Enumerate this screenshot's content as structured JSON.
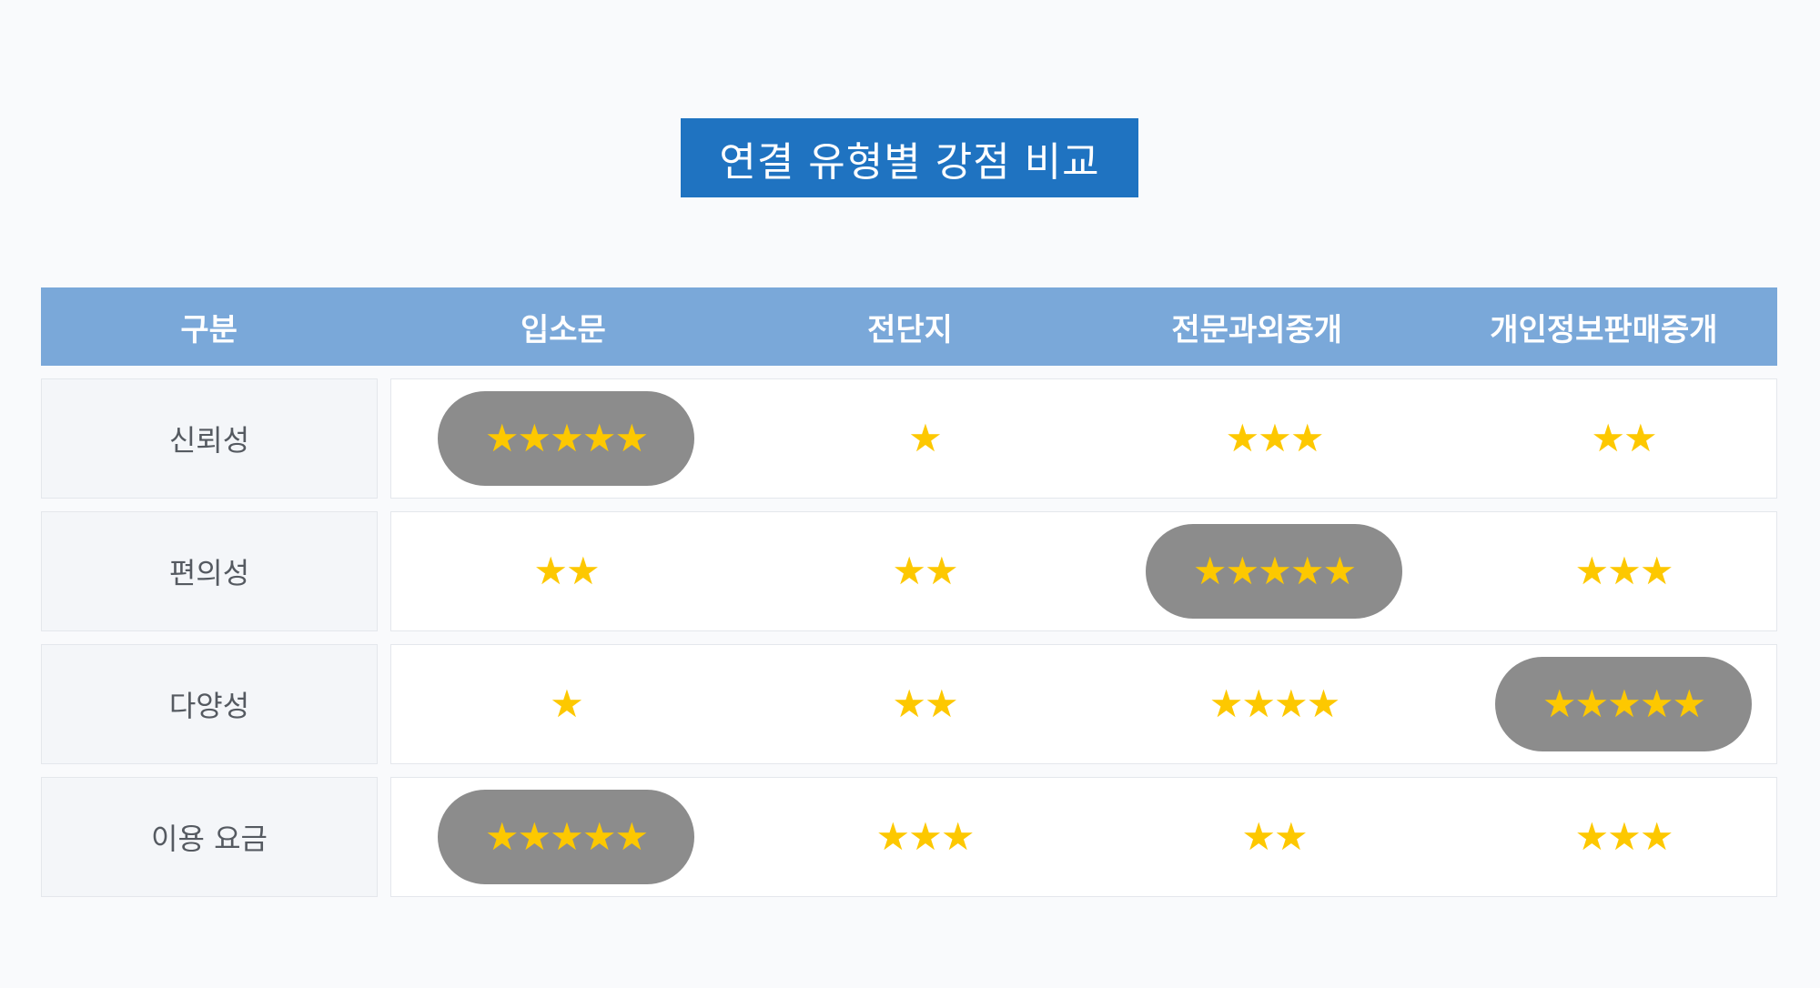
{
  "title": "연결 유형별 강점 비교",
  "colors": {
    "title_bg": "#1f73c1",
    "header_bg": "#7aa8d9",
    "star": "#fdc800",
    "highlight_pill": "#8c8c8c"
  },
  "header": {
    "category": "구분",
    "columns": [
      "입소문",
      "전단지",
      "전문과외중개",
      "개인정보판매중개"
    ]
  },
  "rows": [
    {
      "label": "신뢰성",
      "ratings": [
        {
          "stars": "★★★★★",
          "value": 5,
          "highlight": true
        },
        {
          "stars": "★",
          "value": 1,
          "highlight": false
        },
        {
          "stars": "★★★",
          "value": 3,
          "highlight": false
        },
        {
          "stars": "★★",
          "value": 2,
          "highlight": false
        }
      ]
    },
    {
      "label": "편의성",
      "ratings": [
        {
          "stars": "★★",
          "value": 2,
          "highlight": false
        },
        {
          "stars": "★★",
          "value": 2,
          "highlight": false
        },
        {
          "stars": "★★★★★",
          "value": 5,
          "highlight": true
        },
        {
          "stars": "★★★",
          "value": 3,
          "highlight": false
        }
      ]
    },
    {
      "label": "다양성",
      "ratings": [
        {
          "stars": "★",
          "value": 1,
          "highlight": false
        },
        {
          "stars": "★★",
          "value": 2,
          "highlight": false
        },
        {
          "stars": "★★★★",
          "value": 4,
          "highlight": false
        },
        {
          "stars": "★★★★★",
          "value": 5,
          "highlight": true
        }
      ]
    },
    {
      "label": "이용 요금",
      "ratings": [
        {
          "stars": "★★★★★",
          "value": 5,
          "highlight": true
        },
        {
          "stars": "★★★",
          "value": 3,
          "highlight": false
        },
        {
          "stars": "★★",
          "value": 2,
          "highlight": false
        },
        {
          "stars": "★★★",
          "value": 3,
          "highlight": false
        }
      ]
    }
  ]
}
